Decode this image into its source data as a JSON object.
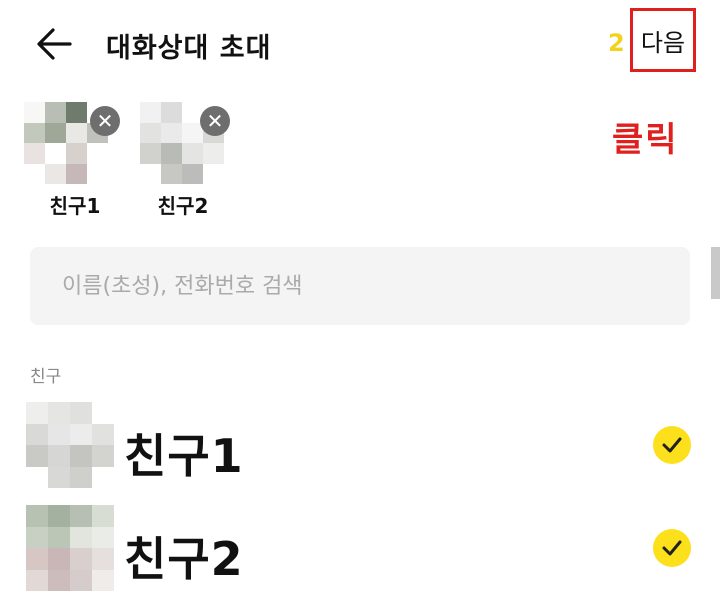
{
  "header": {
    "title": "대화상대 초대",
    "selected_count": "2",
    "next_label": "다음"
  },
  "annotation": {
    "label": "클릭",
    "color": "#e0201e"
  },
  "selected": [
    {
      "name": "친구1"
    },
    {
      "name": "친구2"
    }
  ],
  "search": {
    "placeholder": "이름(초성), 전화번호 검색",
    "value": ""
  },
  "section": {
    "label": "친구"
  },
  "friends": [
    {
      "name": "친구1",
      "checked": true
    },
    {
      "name": "친구2",
      "checked": true
    }
  ],
  "colors": {
    "accent": "#fde01c",
    "count": "#f2d21b",
    "highlight": "#e0201e"
  },
  "icons": {
    "back": "arrow-left-icon",
    "remove": "close-icon",
    "check": "checkmark-icon"
  }
}
